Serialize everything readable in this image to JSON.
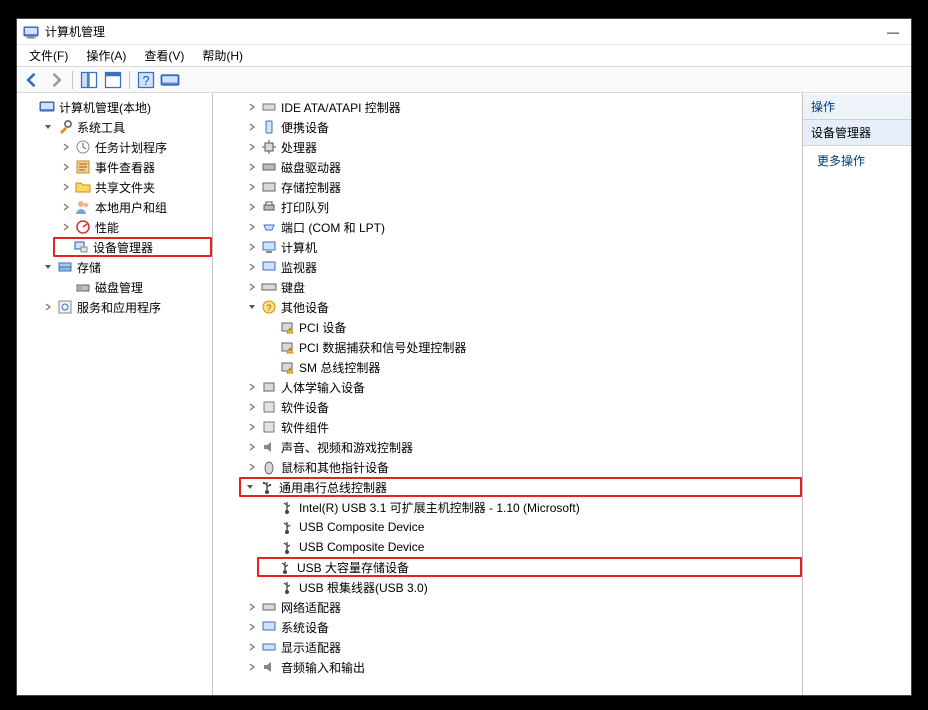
{
  "window": {
    "title": "计算机管理",
    "minimize": "—"
  },
  "menu": {
    "file": "文件(F)",
    "action": "操作(A)",
    "view": "查看(V)",
    "help": "帮助(H)"
  },
  "right": {
    "header": "操作",
    "section": "设备管理器",
    "more": "更多操作"
  },
  "left_tree": {
    "root": "计算机管理(本地)",
    "systools": "系统工具",
    "task_sched": "任务计划程序",
    "event_viewer": "事件查看器",
    "shared_folders": "共享文件夹",
    "local_users": "本地用户和组",
    "perf": "性能",
    "device_manager": "设备管理器",
    "storage": "存储",
    "disk_mgmt": "磁盘管理",
    "services_apps": "服务和应用程序"
  },
  "center_tree": {
    "ide": "IDE ATA/ATAPI 控制器",
    "portable": "便携设备",
    "processors": "处理器",
    "disk_drives": "磁盘驱动器",
    "storage_ctrl": "存储控制器",
    "print_queues": "打印队列",
    "ports": "端口 (COM 和 LPT)",
    "computer": "计算机",
    "monitors": "监视器",
    "keyboards": "键盘",
    "other_devices": "其他设备",
    "other_pci": "PCI 设备",
    "other_pci_dacap": "PCI 数据捕获和信号处理控制器",
    "other_sm": "SM 总线控制器",
    "hid": "人体学输入设备",
    "software_dev": "软件设备",
    "software_comp": "软件组件",
    "sound": "声音、视频和游戏控制器",
    "mouse": "鼠标和其他指针设备",
    "usb_ctrl": "通用串行总线控制器",
    "usb_intel": "Intel(R) USB 3.1 可扩展主机控制器 - 1.10 (Microsoft)",
    "usb_comp1": "USB Composite Device",
    "usb_comp2": "USB Composite Device",
    "usb_mass": "USB 大容量存储设备",
    "usb_root": "USB 根集线器(USB 3.0)",
    "net_adapters": "网络适配器",
    "sys_devices": "系统设备",
    "display": "显示适配器",
    "audio_io": "音频输入和输出"
  }
}
